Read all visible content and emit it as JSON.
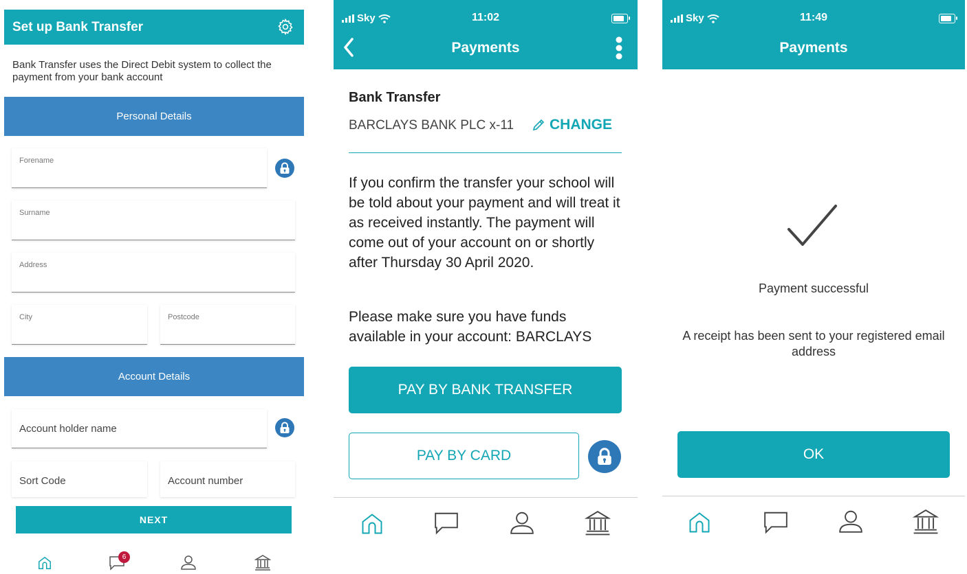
{
  "screen1": {
    "title": "Set up Bank Transfer",
    "intro": "Bank Transfer uses the Direct Debit system to collect the payment from your bank account",
    "personal_section": "Personal Details",
    "fields": {
      "forename": "Forename",
      "surname": "Surname",
      "address": "Address",
      "city": "City",
      "postcode": "Postcode"
    },
    "account_section": "Account Details",
    "account_fields": {
      "holder": "Account holder name",
      "sort_code": "Sort Code",
      "account_number": "Account number"
    },
    "next_label": "NEXT",
    "messages_badge": "6",
    "icons": [
      "gear-icon",
      "lock-icon",
      "home-icon",
      "chat-icon",
      "profile-icon",
      "bank-icon"
    ]
  },
  "screen2": {
    "carrier": "Sky",
    "time": "11:02",
    "title": "Payments",
    "section_title": "Bank Transfer",
    "bank": "BARCLAYS BANK PLC x-11",
    "change_label": "CHANGE",
    "paragraph1": "If you confirm the transfer your school will be told about your payment and will treat it as received instantly. The payment will come out of your account on or shortly after Thursday 30 April 2020.",
    "paragraph2": "Please make sure you have funds available in your account: BARCLAYS",
    "pay_bank_label": "PAY BY BANK TRANSFER",
    "pay_card_label": "PAY BY CARD"
  },
  "screen3": {
    "carrier": "Sky",
    "time": "11:49",
    "title": "Payments",
    "success": "Payment successful",
    "receipt": "A receipt has been sent to your registered email address",
    "ok_label": "OK"
  },
  "colors": {
    "teal": "#13a6b4",
    "section_blue": "#3c87c3",
    "lock_blue": "#2f78b8",
    "badge_red": "#c0183d"
  }
}
